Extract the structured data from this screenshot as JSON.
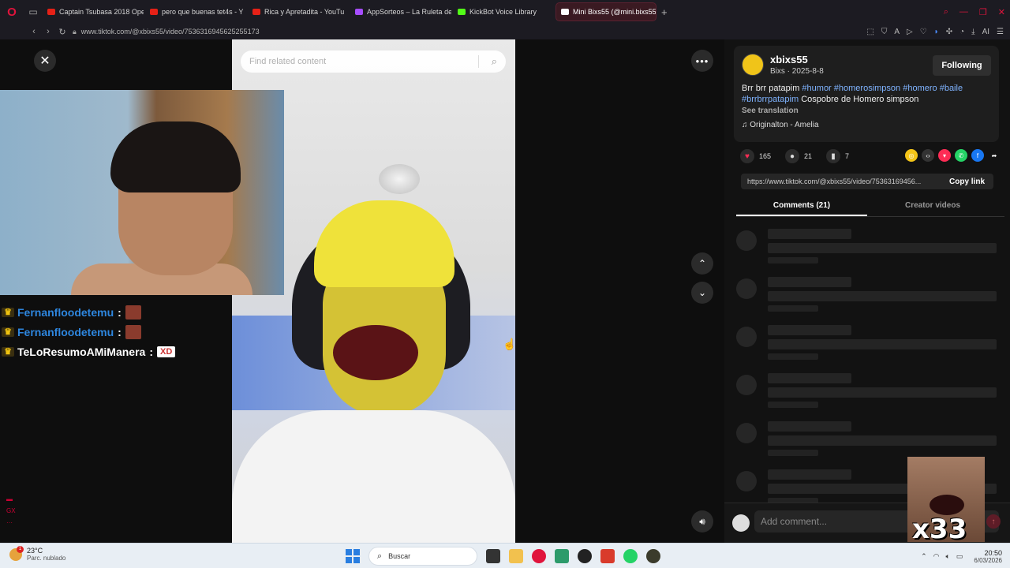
{
  "browser": {
    "tabs": [
      {
        "label": "Captain Tsubasa 2018 Ope",
        "color": "#e62117",
        "active": false
      },
      {
        "label": "pero que buenas tet4s - Y",
        "color": "#e62117",
        "active": false
      },
      {
        "label": "Rica y Apretadita - YouTu",
        "color": "#e62117",
        "active": false
      },
      {
        "label": "AppSorteos – La Ruleta de",
        "color": "#a64dff",
        "active": false
      },
      {
        "label": "KickBot Voice Library",
        "color": "#53fc18",
        "active": false
      },
      {
        "label": "Mini Bixs55 (@mini.bixs55",
        "color": "#ffffff",
        "active": true
      }
    ],
    "new_tab": "+",
    "url": "www.tiktok.com/@xbixs55/video/7536316945625255173",
    "ai_label": "AI"
  },
  "video": {
    "search_placeholder": "Find related content",
    "close_icon": "close-icon",
    "more_icon": "more-icon"
  },
  "chat": {
    "rows": [
      {
        "user": "Fernanfloodetemu",
        "color": "#2e86de",
        "emote": "face"
      },
      {
        "user": "Fernanfloodetemu",
        "color": "#2e86de",
        "emote": "face"
      },
      {
        "user": "TeLoResumoAMiManera",
        "color": "#ffffff",
        "emote": "XD"
      }
    ],
    "colon": ":"
  },
  "post": {
    "username": "xbixs55",
    "subline": "Bixs · 2025-8-8",
    "follow_label": "Following",
    "caption_prefix": "Brr brr patapim ",
    "tags": [
      "#humor",
      "#homerosimpson",
      "#homero",
      "#baile",
      "#brrbrrpatapim"
    ],
    "caption_suffix": " Cospobre de Homero simpson",
    "see_translation": "See translation",
    "music": "Originalton - Amelia",
    "likes": "165",
    "comments": "21",
    "saves": "7",
    "link": "https://www.tiktok.com/@xbixs55/video/75363169456...",
    "copy_label": "Copy link",
    "tab_comments": "Comments (21)",
    "tab_creator": "Creator videos",
    "comment_placeholder": "Add comment..."
  },
  "reaction": {
    "count": "x33"
  },
  "taskbar": {
    "temp": "23°C",
    "weather_desc": "Parc. nublado",
    "weather_badge": "1",
    "search_label": "Buscar",
    "time": "20:50",
    "date": "6/03/2026"
  }
}
